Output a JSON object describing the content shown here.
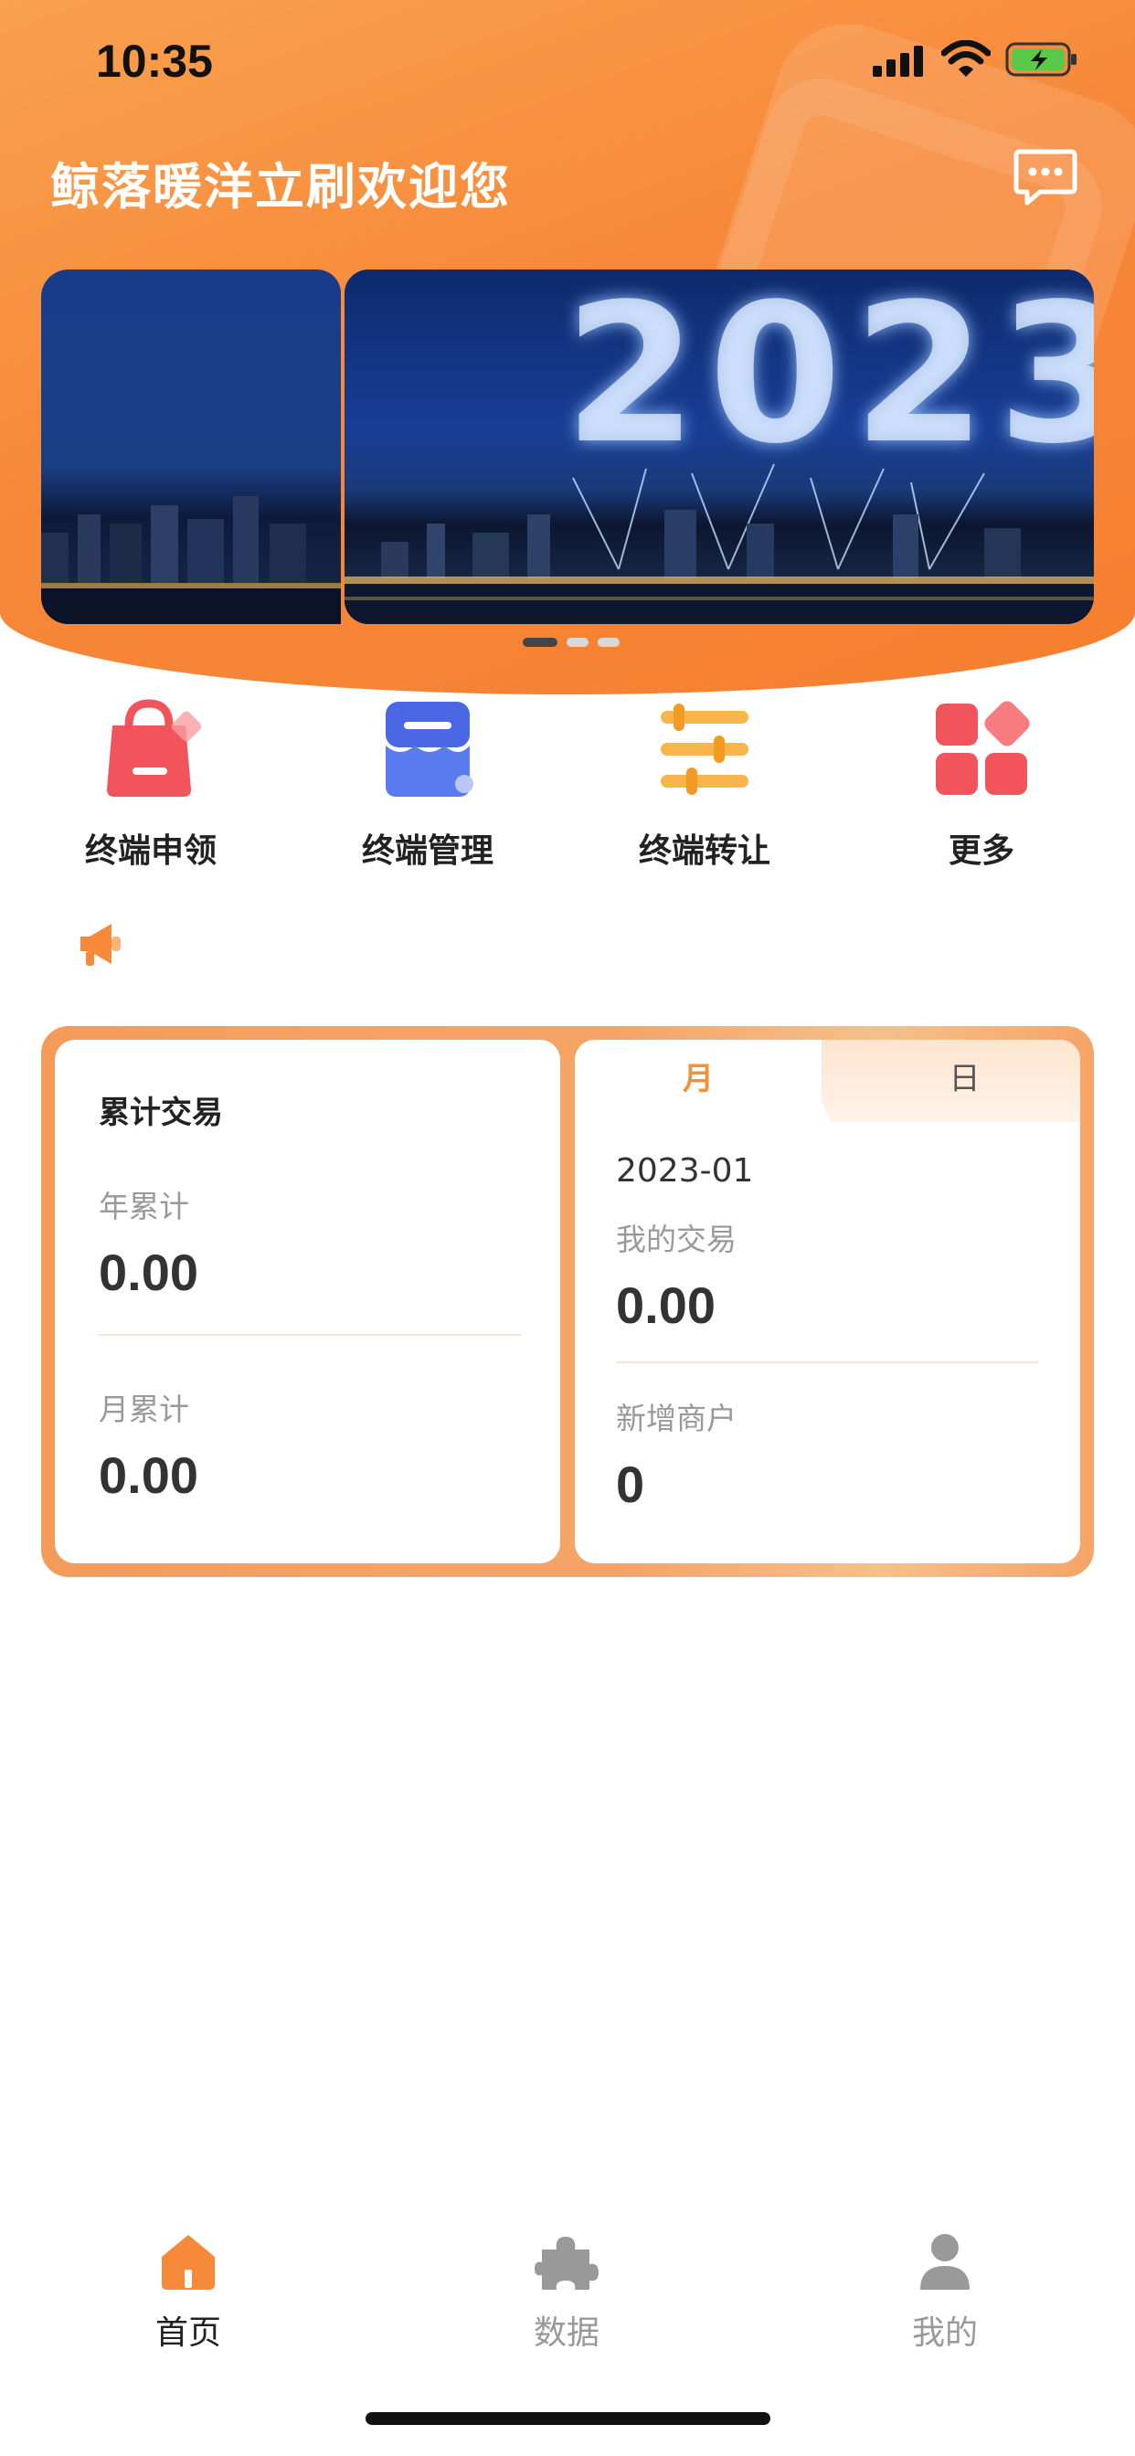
{
  "status_bar": {
    "time": "10:35"
  },
  "header": {
    "welcome_text": "鲸落暖洋立刷欢迎您",
    "message_icon": "chat-bubble-icon"
  },
  "banner": {
    "slide_text": "2023",
    "active_index": 0,
    "dot_count": 3
  },
  "quick_menu": {
    "items": [
      {
        "label": "终端申领",
        "icon": "shopping-bag-icon",
        "color": "#f2545b"
      },
      {
        "label": "终端管理",
        "icon": "store-icon",
        "color": "#4a67e6"
      },
      {
        "label": "终端转让",
        "icon": "sliders-icon",
        "color": "#f7a634"
      },
      {
        "label": "更多",
        "icon": "grid-icon",
        "color": "#f2545b"
      }
    ]
  },
  "notice": {
    "icon": "megaphone-icon"
  },
  "stats": {
    "cumulative": {
      "title": "累计交易",
      "year_label": "年累计",
      "year_value": "0.00",
      "month_label": "月累计",
      "month_value": "0.00"
    },
    "period": {
      "tab_month": "月",
      "tab_day": "日",
      "selected_tab": "月",
      "date": "2023-01",
      "my_trade_label": "我的交易",
      "my_trade_value": "0.00",
      "new_merchants_label": "新增商户",
      "new_merchants_value": "0"
    }
  },
  "tabbar": {
    "items": [
      {
        "label": "首页",
        "icon": "home-icon",
        "active": true
      },
      {
        "label": "数据",
        "icon": "puzzle-icon",
        "active": false
      },
      {
        "label": "我的",
        "icon": "person-icon",
        "active": false
      }
    ]
  },
  "colors": {
    "accent": "#f7893a",
    "active_tab_text": "#222222",
    "inactive_tab_text": "#999999"
  }
}
